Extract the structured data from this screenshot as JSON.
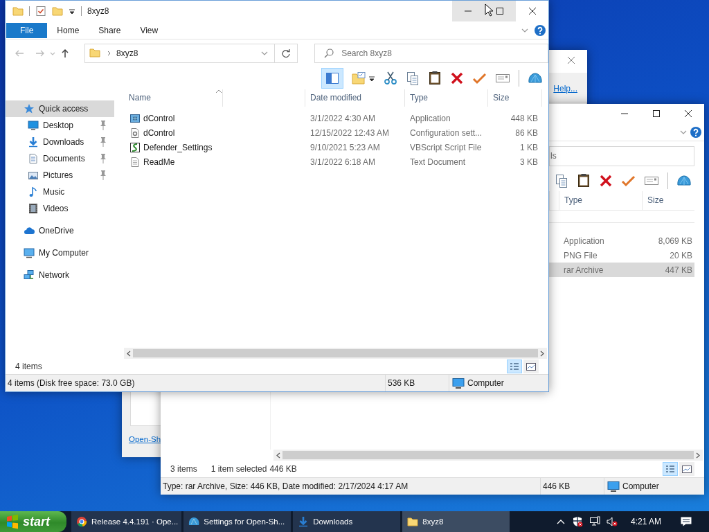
{
  "dialog": {
    "help_link": "Help...",
    "bottom_link": "Open-Sh"
  },
  "downloads_window": {
    "search_fragment": "ls",
    "columns": [
      "Type",
      "Size"
    ],
    "rows": [
      {
        "type": "Application",
        "size": "8,069 KB",
        "selected": false
      },
      {
        "type": "PNG File",
        "size": "20 KB",
        "selected": false
      },
      {
        "type": "rar Archive",
        "size": "447 KB",
        "selected": true
      }
    ],
    "item_count": "3 items",
    "selection": "1 item selected",
    "selection_size": "446 KB",
    "view_buttons": [
      {
        "selected": true
      },
      {
        "selected": false
      }
    ],
    "status_bar": {
      "details": "Type: rar Archive, Size: 446 KB, Date modified: 2/17/2024 4:17 AM",
      "size": "446 KB",
      "location": "Computer"
    }
  },
  "explorer": {
    "title": "8xyz8",
    "ribbon_tabs": [
      {
        "label": "File",
        "kind": "file"
      },
      {
        "label": "Home",
        "kind": "tab"
      },
      {
        "label": "Share",
        "kind": "tab"
      },
      {
        "label": "View",
        "kind": "tab"
      }
    ],
    "address": {
      "breadcrumb": "8xyz8"
    },
    "search": {
      "placeholder": "Search 8xyz8"
    },
    "sidebar": {
      "items": [
        {
          "label": "Quick access",
          "kind": "star",
          "selected": true,
          "children": [
            {
              "label": "Desktop",
              "kind": "desktop",
              "pinned": true,
              "selected": false
            },
            {
              "label": "Downloads",
              "kind": "download",
              "pinned": true,
              "selected": false
            },
            {
              "label": "Documents",
              "kind": "documents",
              "pinned": true,
              "selected": false
            },
            {
              "label": "Pictures",
              "kind": "pictures",
              "pinned": true,
              "selected": false
            },
            {
              "label": "Music",
              "kind": "music",
              "pinned": false,
              "selected": false
            },
            {
              "label": "Videos",
              "kind": "videos",
              "pinned": false,
              "selected": false
            }
          ]
        },
        {
          "label": "OneDrive",
          "kind": "cloud",
          "selected": false
        },
        {
          "label": "My Computer",
          "kind": "computer",
          "selected": false
        },
        {
          "label": "Network",
          "kind": "network",
          "selected": false
        }
      ]
    },
    "columns": [
      "Name",
      "Date modified",
      "Type",
      "Size"
    ],
    "rows": [
      {
        "kind": "application",
        "name": "dControl",
        "date": "3/1/2022 4:30 AM",
        "type": "Application",
        "size": "448 KB",
        "selected": false
      },
      {
        "kind": "config",
        "name": "dControl",
        "date": "12/15/2022 12:43 AM",
        "type": "Configuration sett...",
        "size": "86 KB",
        "selected": false
      },
      {
        "kind": "script",
        "name": "Defender_Settings",
        "date": "9/10/2021 5:23 AM",
        "type": "VBScript Script File",
        "size": "1 KB",
        "selected": false
      },
      {
        "kind": "text",
        "name": "ReadMe",
        "date": "3/1/2022 6:18 AM",
        "type": "Text Document",
        "size": "3 KB",
        "selected": false
      }
    ],
    "item_count": "4 items",
    "view_buttons": [
      {
        "selected": true
      },
      {
        "selected": false
      }
    ],
    "status_bar": {
      "details": "4 items (Disk free space: 73.0 GB)",
      "size": "536 KB",
      "location": "Computer"
    }
  },
  "taskbar": {
    "start": "start",
    "tasks": [
      {
        "label": "Release 4.4.191 · Ope...",
        "kind": "browser",
        "selected": false
      },
      {
        "label": "Settings for Open-Sh...",
        "kind": "shell",
        "selected": false
      },
      {
        "label": "Downloads",
        "kind": "download",
        "selected": false
      },
      {
        "label": "8xyz8",
        "kind": "folder",
        "selected": true
      }
    ],
    "clock": "4:21 AM"
  }
}
